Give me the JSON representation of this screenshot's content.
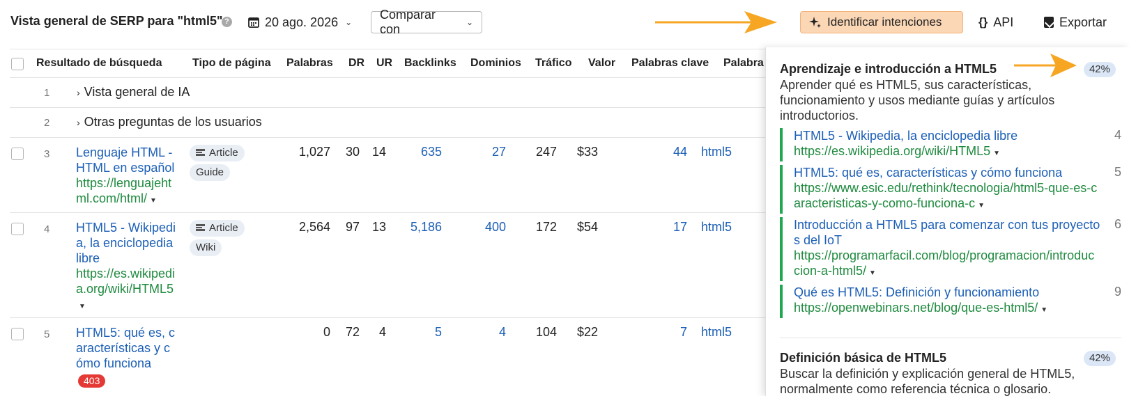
{
  "header": {
    "title": "Vista general de SERP para \"html5\"",
    "date": "20 ago. 2026",
    "compare_label": "Comparar con",
    "identify_label": "Identificar intenciones",
    "api_label": "API",
    "export_label": "Exportar",
    "accent_color": "#fbd7b6",
    "arrow_color": "#f7a623"
  },
  "table": {
    "columns": [
      "Resultado de búsqueda",
      "Tipo de página",
      "Palabras",
      "DR",
      "UR",
      "Backlinks",
      "Dominios",
      "Tráfico",
      "Valor",
      "Palabras clave",
      "Palabra"
    ],
    "group_rows": [
      {
        "num": "1",
        "label": "Vista general de IA"
      },
      {
        "num": "2",
        "label": "Otras preguntas de los usuarios"
      }
    ],
    "rows": [
      {
        "num": "3",
        "title": "Lenguaje HTML - HTML en español",
        "url": "https://lenguajehtml.com/html/",
        "badges": [
          "Article",
          "Guide"
        ],
        "words": "1,027",
        "dr": "30",
        "ur": "14",
        "backlinks": "635",
        "domains": "27",
        "traffic": "247",
        "value": "$33",
        "keywords": "44",
        "top_keyword": "html5"
      },
      {
        "num": "4",
        "title": "HTML5 - Wikipedia, la enciclopedia libre",
        "url": "https://es.wikipedia.org/wiki/HTML5",
        "badges": [
          "Article",
          "Wiki"
        ],
        "words": "2,564",
        "dr": "97",
        "ur": "13",
        "backlinks": "5,186",
        "domains": "400",
        "traffic": "172",
        "value": "$54",
        "keywords": "17",
        "top_keyword": "html5"
      },
      {
        "num": "5",
        "title": "HTML5: qué es, características y cómo funciona",
        "error": "403",
        "words": "0",
        "dr": "72",
        "ur": "4",
        "backlinks": "5",
        "domains": "4",
        "traffic": "104",
        "value": "$22",
        "keywords": "7",
        "top_keyword": "html5"
      }
    ]
  },
  "panel": {
    "intents": [
      {
        "title": "Aprendizaje e introducción a HTML5",
        "pct": "42%",
        "desc": "Aprender qué es HTML5, sus características, funcionamiento y usos mediante guías y artículos introductorios.",
        "results": [
          {
            "title": "HTML5 - Wikipedia, la enciclopedia libre",
            "url": "https://es.wikipedia.org/wiki/HTML5",
            "pos": "4"
          },
          {
            "title": "HTML5: qué es, características y cómo funciona",
            "url": "https://www.esic.edu/rethink/tecnologia/html5-que-es-caracteristicas-y-como-funciona-c",
            "pos": "5"
          },
          {
            "title": "Introducción a HTML5 para comenzar con tus proyectos del IoT",
            "url": "https://programarfacil.com/blog/programacion/introduccion-a-html5/",
            "pos": "6"
          },
          {
            "title": "Qué es HTML5: Definición y funcionamiento",
            "url": "https://openwebinars.net/blog/que-es-html5/",
            "pos": "9"
          }
        ]
      },
      {
        "title": "Definición básica de HTML5",
        "pct": "42%",
        "desc": "Buscar la definición y explicación general de HTML5, normalmente como referencia técnica o glosario."
      }
    ]
  }
}
